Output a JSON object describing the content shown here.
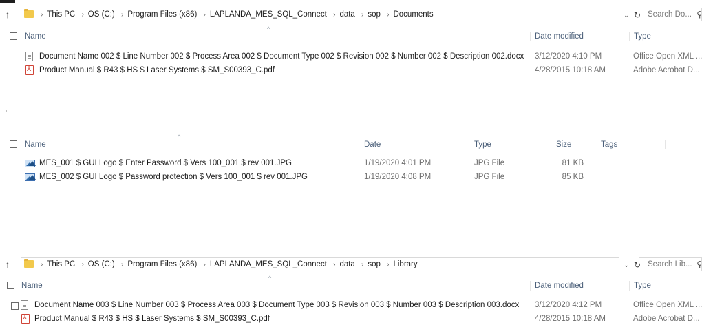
{
  "pane1": {
    "breadcrumbs": [
      "This PC",
      "OS (C:)",
      "Program Files (x86)",
      "LAPLANDA_MES_SQL_Connect",
      "data",
      "sop",
      "Documents"
    ],
    "search_placeholder": "Search Do...",
    "columns": {
      "name": "Name",
      "date": "Date modified",
      "type": "Type"
    },
    "files": [
      {
        "name": "Document Name 002 $ Line Number 002 $ Process Area 002 $ Document Type 002 $ Revision 002 $ Number 002 $ Description 002.docx",
        "date": "3/12/2020 4:10 PM",
        "type": "Office Open XML ...",
        "icon": "docx-file-icon"
      },
      {
        "name": "Product Manual $ R43 $ HS $ Laser Systems $ SM_S00393_C.pdf",
        "date": "4/28/2015 10:18 AM",
        "type": "Adobe Acrobat D...",
        "icon": "pdf-file-icon"
      }
    ]
  },
  "pane2": {
    "columns": {
      "name": "Name",
      "date": "Date",
      "type": "Type",
      "size": "Size",
      "tags": "Tags"
    },
    "files": [
      {
        "name": "MES_001 $ GUI Logo $ Enter Password $ Vers 100_001 $ rev 001.JPG",
        "date": "1/19/2020 4:01 PM",
        "type": "JPG File",
        "size": "81 KB",
        "icon": "jpg-file-icon"
      },
      {
        "name": "MES_002 $ GUI Logo $ Password protection $ Vers 100_001 $ rev 001.JPG",
        "date": "1/19/2020 4:08 PM",
        "type": "JPG File",
        "size": "85 KB",
        "icon": "jpg-file-icon"
      }
    ]
  },
  "pane3": {
    "breadcrumbs": [
      "This PC",
      "OS (C:)",
      "Program Files (x86)",
      "LAPLANDA_MES_SQL_Connect",
      "data",
      "sop",
      "Library"
    ],
    "search_placeholder": "Search Lib...",
    "columns": {
      "name": "Name",
      "date": "Date modified",
      "type": "Type"
    },
    "files": [
      {
        "name": "Document Name 003 $ Line Number 003 $ Process Area 003 $ Document Type 003 $ Revision 003 $ Number 003 $ Description 003.docx",
        "date": "3/12/2020 4:12 PM",
        "type": "Office Open XML ...",
        "icon": "docx-file-icon"
      },
      {
        "name": "Product Manual $ R43 $ HS $ Laser Systems $ SM_S00393_C.pdf",
        "date": "4/28/2015 10:18 AM",
        "type": "Adobe Acrobat D...",
        "icon": "pdf-file-icon"
      }
    ]
  }
}
